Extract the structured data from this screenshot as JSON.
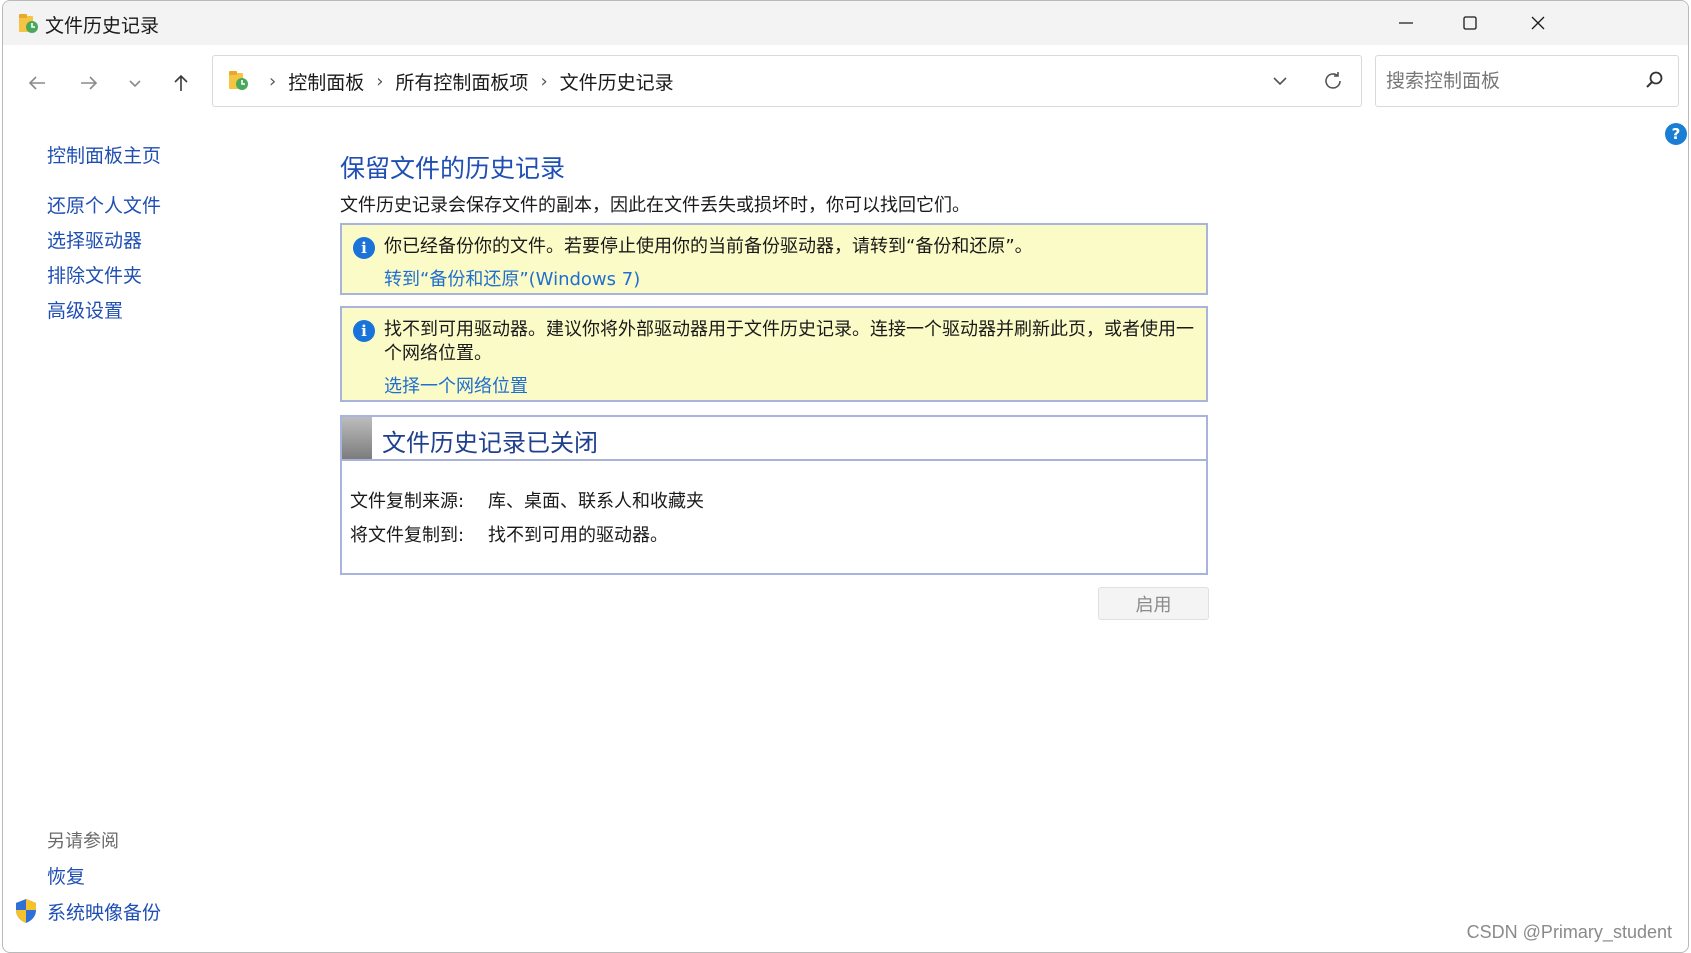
{
  "window": {
    "title": "文件历史记录"
  },
  "address": {
    "breadcrumbs": [
      "控制面板",
      "所有控制面板项",
      "文件历史记录"
    ]
  },
  "search": {
    "placeholder": "搜索控制面板"
  },
  "leftnav": {
    "home": "控制面板主页",
    "tasks": [
      "还原个人文件",
      "选择驱动器",
      "排除文件夹",
      "高级设置"
    ]
  },
  "see_also": {
    "title": "另请参阅",
    "items": [
      "恢复",
      "系统映像备份"
    ]
  },
  "main": {
    "heading": "保留文件的历史记录",
    "description": "文件历史记录会保存文件的副本，因此在文件丢失或损坏时，你可以找回它们。",
    "info1": {
      "message": "你已经备份你的文件。若要停止使用你的当前备份驱动器，请转到“备份和还原”。",
      "link": "转到“备份和还原”(Windows 7)"
    },
    "info2": {
      "message": "找不到可用驱动器。建议你将外部驱动器用于文件历史记录。连接一个驱动器并刷新此页，或者使用一个网络位置。",
      "link": "选择一个网络位置"
    },
    "status": {
      "title": "文件历史记录已关闭",
      "copy_from_label": "文件复制来源:",
      "copy_from_value": "库、桌面、联系人和收藏夹",
      "copy_to_label": "将文件复制到:",
      "copy_to_value": "找不到可用的驱动器。"
    },
    "enable_button": "启用"
  },
  "help": {
    "label": "?"
  },
  "watermark": "CSDN @Primary_student",
  "colors": {
    "link": "#1f4fb3",
    "info_bg": "#fbfbc8",
    "border": "#a9b4dc"
  }
}
